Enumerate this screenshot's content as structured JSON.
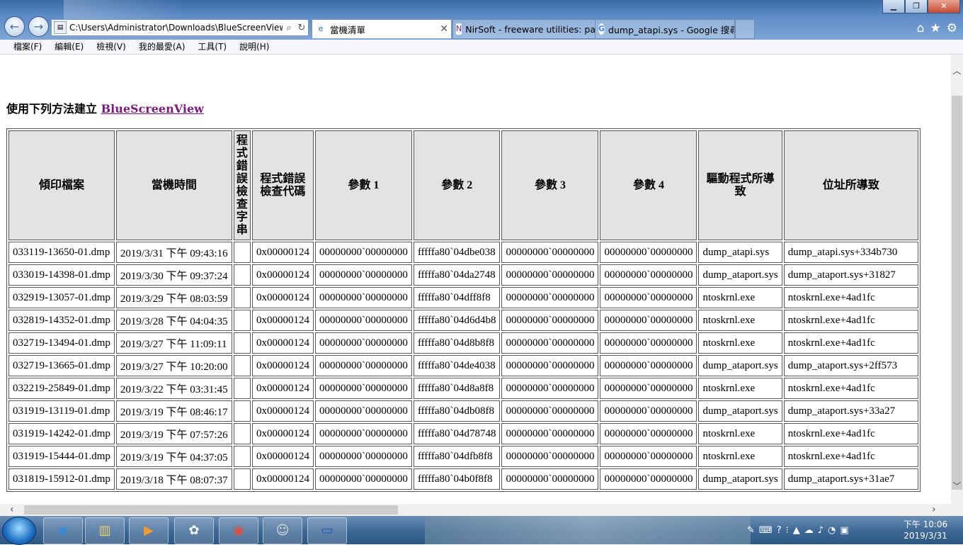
{
  "browser": {
    "address": "C:\\Users\\Administrator\\Downloads\\BlueScreenView",
    "tabs": [
      {
        "label": "當機清單",
        "active": true
      },
      {
        "label": "NirSoft - freeware utilities: pa..."
      },
      {
        "label": "dump_atapi.sys - Google 搜尋"
      }
    ],
    "menu": [
      "檔案(F)",
      "編輯(E)",
      "檢視(V)",
      "我的最愛(A)",
      "工具(T)",
      "說明(H)"
    ]
  },
  "page": {
    "heading_prefix": "使用下列方法建立",
    "heading_link": "BlueScreenView",
    "columns": [
      "傾印檔案",
      "當機時間",
      "程式錯誤檢查字串",
      "程式錯誤檢查代碼",
      "參數 1",
      "參數 2",
      "參數 3",
      "參數 4",
      "驅動程式所導致",
      "位址所導致"
    ],
    "rows": [
      [
        "033119-13650-01.dmp",
        "2019/3/31 下午 09:43:16",
        "",
        "0x00000124",
        "00000000`00000000",
        "fffffa80`04dbe038",
        "00000000`00000000",
        "00000000`00000000",
        "dump_atapi.sys",
        "dump_atapi.sys+334b730"
      ],
      [
        "033019-14398-01.dmp",
        "2019/3/30 下午 09:37:24",
        "",
        "0x00000124",
        "00000000`00000000",
        "fffffa80`04da2748",
        "00000000`00000000",
        "00000000`00000000",
        "dump_ataport.sys",
        "dump_ataport.sys+31827"
      ],
      [
        "032919-13057-01.dmp",
        "2019/3/29 下午 08:03:59",
        "",
        "0x00000124",
        "00000000`00000000",
        "fffffa80`04dff8f8",
        "00000000`00000000",
        "00000000`00000000",
        "ntoskrnl.exe",
        "ntoskrnl.exe+4ad1fc"
      ],
      [
        "032819-14352-01.dmp",
        "2019/3/28 下午 04:04:35",
        "",
        "0x00000124",
        "00000000`00000000",
        "fffffa80`04d6d4b8",
        "00000000`00000000",
        "00000000`00000000",
        "ntoskrnl.exe",
        "ntoskrnl.exe+4ad1fc"
      ],
      [
        "032719-13494-01.dmp",
        "2019/3/27 下午 11:09:11",
        "",
        "0x00000124",
        "00000000`00000000",
        "fffffa80`04d8b8f8",
        "00000000`00000000",
        "00000000`00000000",
        "ntoskrnl.exe",
        "ntoskrnl.exe+4ad1fc"
      ],
      [
        "032719-13665-01.dmp",
        "2019/3/27 下午 10:20:00",
        "",
        "0x00000124",
        "00000000`00000000",
        "fffffa80`04de4038",
        "00000000`00000000",
        "00000000`00000000",
        "dump_ataport.sys",
        "dump_ataport.sys+2ff573"
      ],
      [
        "032219-25849-01.dmp",
        "2019/3/22 下午 03:31:45",
        "",
        "0x00000124",
        "00000000`00000000",
        "fffffa80`04d8a8f8",
        "00000000`00000000",
        "00000000`00000000",
        "ntoskrnl.exe",
        "ntoskrnl.exe+4ad1fc"
      ],
      [
        "031919-13119-01.dmp",
        "2019/3/19 下午 08:46:17",
        "",
        "0x00000124",
        "00000000`00000000",
        "fffffa80`04db08f8",
        "00000000`00000000",
        "00000000`00000000",
        "dump_ataport.sys",
        "dump_ataport.sys+33a27"
      ],
      [
        "031919-14242-01.dmp",
        "2019/3/19 下午 07:57:26",
        "",
        "0x00000124",
        "00000000`00000000",
        "fffffa80`04d78748",
        "00000000`00000000",
        "00000000`00000000",
        "ntoskrnl.exe",
        "ntoskrnl.exe+4ad1fc"
      ],
      [
        "031919-15444-01.dmp",
        "2019/3/19 下午 04:37:05",
        "",
        "0x00000124",
        "00000000`00000000",
        "fffffa80`04dfb8f8",
        "00000000`00000000",
        "00000000`00000000",
        "ntoskrnl.exe",
        "ntoskrnl.exe+4ad1fc"
      ],
      [
        "031819-15912-01.dmp",
        "2019/3/18 下午 08:07:37",
        "",
        "0x00000124",
        "00000000`00000000",
        "fffffa80`04b0f8f8",
        "00000000`00000000",
        "00000000`00000000",
        "dump_ataport.sys",
        "dump_ataport.sys+31ae7"
      ]
    ]
  },
  "taskbar": {
    "clock_time": "下午 10:06",
    "clock_date": "2019/3/31",
    "apps": [
      "ie-icon",
      "explorer-icon",
      "media-player-icon",
      "network-app-icon",
      "chrome-icon",
      "game-app-icon",
      "monitor-icon"
    ]
  },
  "colors": {
    "link": "#7a1a7a",
    "header_bg": "#e3e3e3",
    "titlebar": "#5d8bc6"
  }
}
